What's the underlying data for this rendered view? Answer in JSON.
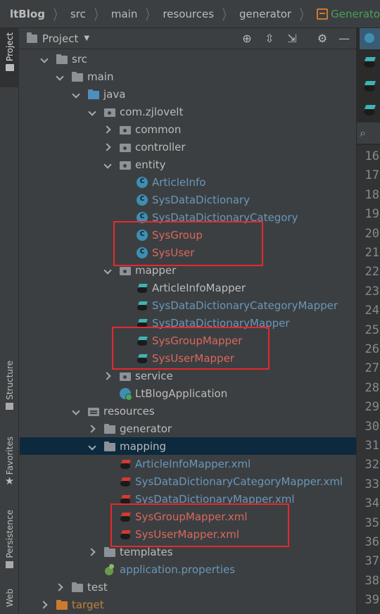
{
  "breadcrumb": {
    "items": [
      "ltBlog",
      "src",
      "main",
      "resources",
      "generator"
    ],
    "active": "GeneratorMapper.xml"
  },
  "left_strip": {
    "project": "Project",
    "structure": "Structure",
    "favorites": "Favorites",
    "persistence": "Persistence",
    "web": "Web"
  },
  "panel": {
    "title": "Project"
  },
  "tree": [
    {
      "label": "src"
    },
    {
      "label": "main"
    },
    {
      "label": "java"
    },
    {
      "label": "com.zjlovelt"
    },
    {
      "label": "common"
    },
    {
      "label": "controller"
    },
    {
      "label": "entity"
    },
    {
      "label": "ArticleInfo"
    },
    {
      "label": "SysDataDictionary"
    },
    {
      "label": "SysDataDictionaryCategory"
    },
    {
      "label": "SysGroup"
    },
    {
      "label": "SysUser"
    },
    {
      "label": "mapper"
    },
    {
      "label": "ArticleInfoMapper"
    },
    {
      "label": "SysDataDictionaryCategoryMapper"
    },
    {
      "label": "SysDataDictionaryMapper"
    },
    {
      "label": "SysGroupMapper"
    },
    {
      "label": "SysUserMapper"
    },
    {
      "label": "service"
    },
    {
      "label": "LtBlogApplication"
    },
    {
      "label": "resources"
    },
    {
      "label": "generator"
    },
    {
      "label": "mapping"
    },
    {
      "label": "ArticleInfoMapper.xml"
    },
    {
      "label": "SysDataDictionaryCategoryMapper.xml"
    },
    {
      "label": "SysDataDictionaryMapper.xml"
    },
    {
      "label": "SysGroupMapper.xml"
    },
    {
      "label": "SysUserMapper.xml"
    },
    {
      "label": "templates"
    },
    {
      "label": "application.properties"
    },
    {
      "label": "test"
    },
    {
      "label": "target"
    }
  ],
  "line_numbers": [
    "16",
    "17",
    "18",
    "19",
    "20",
    "21",
    "22",
    "23",
    "24",
    "25",
    "26",
    "27",
    "28",
    "29",
    "30",
    "31",
    "32",
    "33",
    "34",
    "35",
    "36",
    "37",
    "38",
    "39"
  ],
  "colors": {
    "highlight_box": "#e5292e",
    "selected_row": "#0d293e",
    "class_text": "#6897bb",
    "new_file_text": "#d8685d",
    "excluded_text": "#c0803b"
  }
}
